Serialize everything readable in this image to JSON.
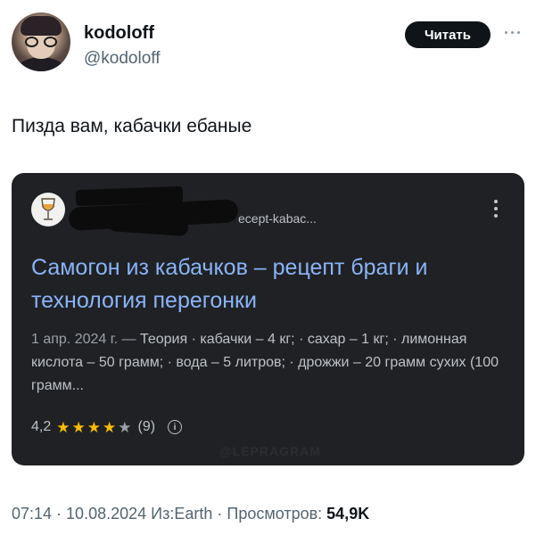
{
  "author": {
    "name": "kodoloff",
    "handle": "@kodoloff"
  },
  "follow_button": {
    "label": "Читать"
  },
  "tweet": {
    "text": "Пизда вам, кабачки ебаные"
  },
  "search_result": {
    "url": "ecept-kabac...",
    "title": "Самогон из кабачков – рецепт браги и технология перегонки",
    "date": "1 апр. 2024 г. — ",
    "snippet": "Теория · кабачки – 4 кг; · сахар – 1 кг; · лимонная кислота – 50 грамм; · вода – 5 литров; · дрожжи – 20 грамм сухих (100 грамм...",
    "rating_value": "4,2",
    "rating_stars": 4,
    "rating_max": 5,
    "review_count": "(9)"
  },
  "watermark": "@LEPRAGRAM",
  "footer": {
    "time": "07:14",
    "date": "10.08.2024",
    "source": "Из:Earth",
    "views_label": "Просмотров:",
    "views_count": "54,9K"
  },
  "colors": {
    "link": "#8ab4f8",
    "card_bg": "#202124",
    "star": "#fbbc04"
  }
}
